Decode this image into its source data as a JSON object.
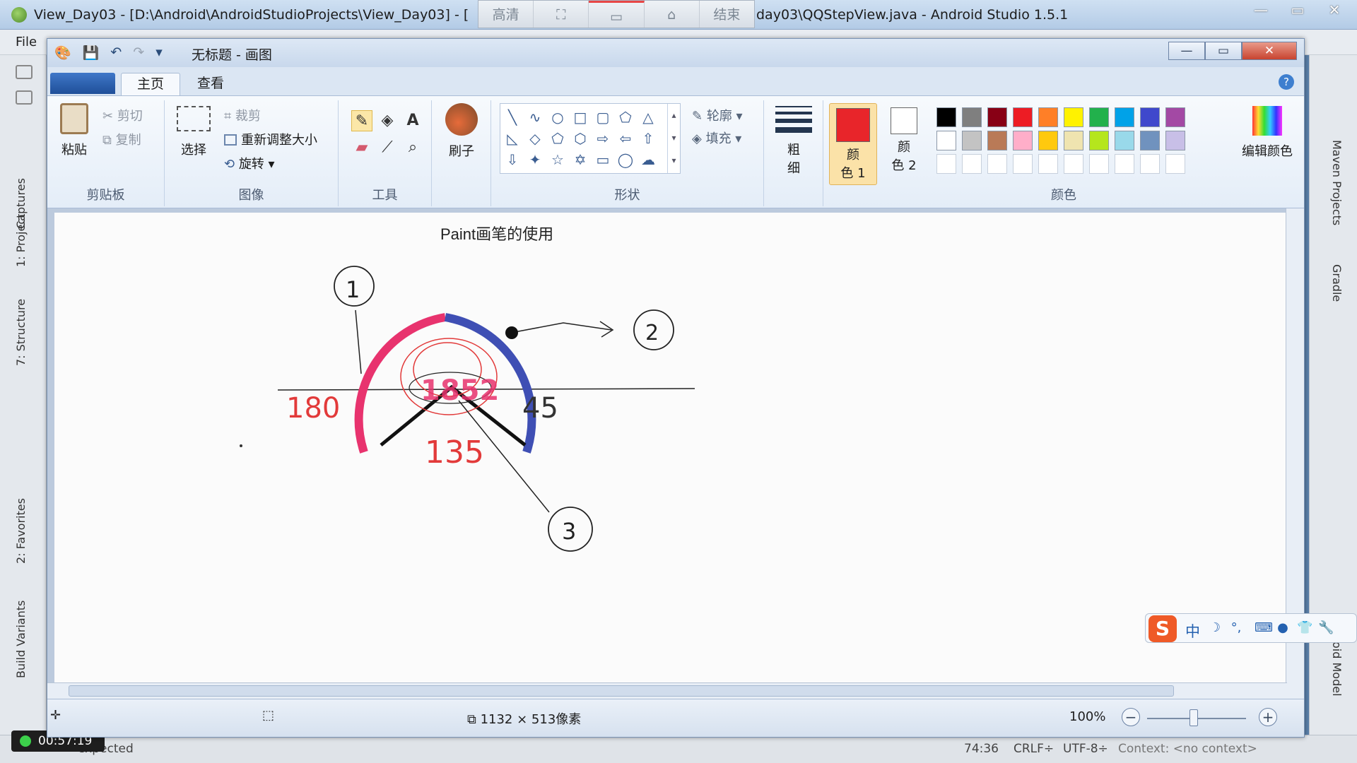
{
  "as_window": {
    "title_left": "View_Day03 - [D:\\Android\\AndroidStudioProjects\\View_Day03] - [",
    "title_right": "day03\\QQStepView.java - Android Studio 1.5.1",
    "recorder_toolbar": [
      "高清",
      "⛶",
      "▭",
      "⌂",
      "结束"
    ],
    "menu_file": "File",
    "left_tabs": [
      "Captures",
      "1: Project",
      "7: Structure",
      "2: Favorites",
      "Build Variants"
    ],
    "right_tabs": [
      "Maven Projects",
      "Gradle",
      "oid Model"
    ],
    "status": {
      "message": "expected",
      "position": "74:36",
      "line_sep": "CRLF÷",
      "encoding": "UTF-8÷",
      "context": "Context: <no context>"
    },
    "timer": "00:57:19"
  },
  "paint": {
    "title": "无标题 - 画图",
    "tabs": [
      "主页",
      "查看"
    ],
    "clipboard": {
      "label": "剪贴板",
      "paste": "粘贴",
      "cut": "剪切",
      "copy": "复制"
    },
    "image": {
      "label": "图像",
      "select": "选择",
      "crop": "裁剪",
      "resize": "重新调整大小",
      "rotate": "旋转"
    },
    "tools": {
      "label": "工具"
    },
    "brush": {
      "label": "刷子"
    },
    "shapes": {
      "label": "形状",
      "outline": "轮廓",
      "fill": "填充"
    },
    "size": {
      "label": "粗\n细"
    },
    "colors": {
      "label": "颜色",
      "color1_label": "颜\n色 1",
      "color2_label": "颜\n色 2",
      "edit": "编辑颜色",
      "color1": "#e8252a",
      "color2": "#ffffff",
      "palette_row1": [
        "#000000",
        "#7f7f7f",
        "#880015",
        "#ed1c24",
        "#ff7f27",
        "#fff200",
        "#22b14c",
        "#00a2e8",
        "#3f48cc",
        "#a349a4"
      ],
      "palette_row2": [
        "#ffffff",
        "#c3c3c3",
        "#b97a57",
        "#ffaec9",
        "#ffc90e",
        "#efe4b0",
        "#b5e61d",
        "#99d9ea",
        "#7092be",
        "#c8bfe7"
      ]
    },
    "canvas": {
      "heading": "Paint画笔的使用",
      "label_1": "1",
      "label_2": "2",
      "label_3": "3",
      "angle_180": "180",
      "angle_45": "45",
      "angle_135": "135",
      "center_value": "1852"
    },
    "status": {
      "size": "1132 × 513像素",
      "zoom": "100%"
    }
  },
  "ime": {
    "mode": "中"
  }
}
